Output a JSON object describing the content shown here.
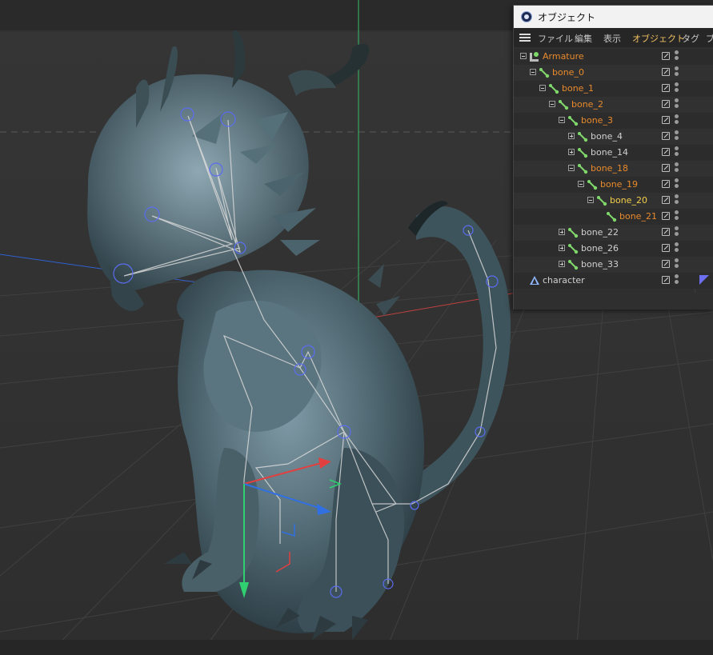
{
  "panel": {
    "title": "オブジェクト",
    "menu": [
      {
        "label": "ファイル",
        "active": false
      },
      {
        "label": "編集",
        "active": false
      },
      {
        "label": "表示",
        "active": false
      },
      {
        "label": "オブジェクト",
        "active": true
      },
      {
        "label": "タグ",
        "active": false
      },
      {
        "label": "ブ",
        "active": false
      }
    ]
  },
  "tree": [
    {
      "id": "armature",
      "label": "Armature",
      "icon": "armature-icon",
      "color": "orange",
      "expander": "minus"
    },
    {
      "id": "bone_0",
      "label": "bone_0",
      "icon": "bone-icon",
      "color": "orange",
      "expander": "minus"
    },
    {
      "id": "bone_1",
      "label": "bone_1",
      "icon": "bone-icon",
      "color": "orange",
      "expander": "minus"
    },
    {
      "id": "bone_2",
      "label": "bone_2",
      "icon": "bone-icon",
      "color": "orange",
      "expander": "minus"
    },
    {
      "id": "bone_3",
      "label": "bone_3",
      "icon": "bone-icon",
      "color": "orange",
      "expander": "minus"
    },
    {
      "id": "bone_4",
      "label": "bone_4",
      "icon": "bone-icon",
      "color": "white",
      "expander": "plus"
    },
    {
      "id": "bone_14",
      "label": "bone_14",
      "icon": "bone-icon",
      "color": "white",
      "expander": "plus"
    },
    {
      "id": "bone_18",
      "label": "bone_18",
      "icon": "bone-icon",
      "color": "orange",
      "expander": "minus"
    },
    {
      "id": "bone_19",
      "label": "bone_19",
      "icon": "bone-icon",
      "color": "orange",
      "expander": "minus"
    },
    {
      "id": "bone_20",
      "label": "bone_20",
      "icon": "bone-icon",
      "color": "yellow",
      "expander": "minus"
    },
    {
      "id": "bone_21",
      "label": "bone_21",
      "icon": "bone-icon",
      "color": "orange",
      "expander": "none"
    },
    {
      "id": "bone_22",
      "label": "bone_22",
      "icon": "bone-icon",
      "color": "white",
      "expander": "plus"
    },
    {
      "id": "bone_26",
      "label": "bone_26",
      "icon": "bone-icon",
      "color": "white",
      "expander": "plus"
    },
    {
      "id": "bone_33",
      "label": "bone_33",
      "icon": "bone-icon",
      "color": "white",
      "expander": "plus"
    },
    {
      "id": "character",
      "label": "character",
      "icon": "mesh-icon",
      "color": "white",
      "expander": "none",
      "tag": "material-tag-icon"
    }
  ],
  "colors": {
    "accent_orange": "#e88a2c",
    "accent_yellow": "#f4d04a",
    "active_menu": "#f0c060",
    "axis_x": "#e04040",
    "axis_y": "#30d070",
    "axis_z": "#3070e0",
    "bone_icon": "#7fd86a",
    "tag": "#6d6ef0"
  }
}
